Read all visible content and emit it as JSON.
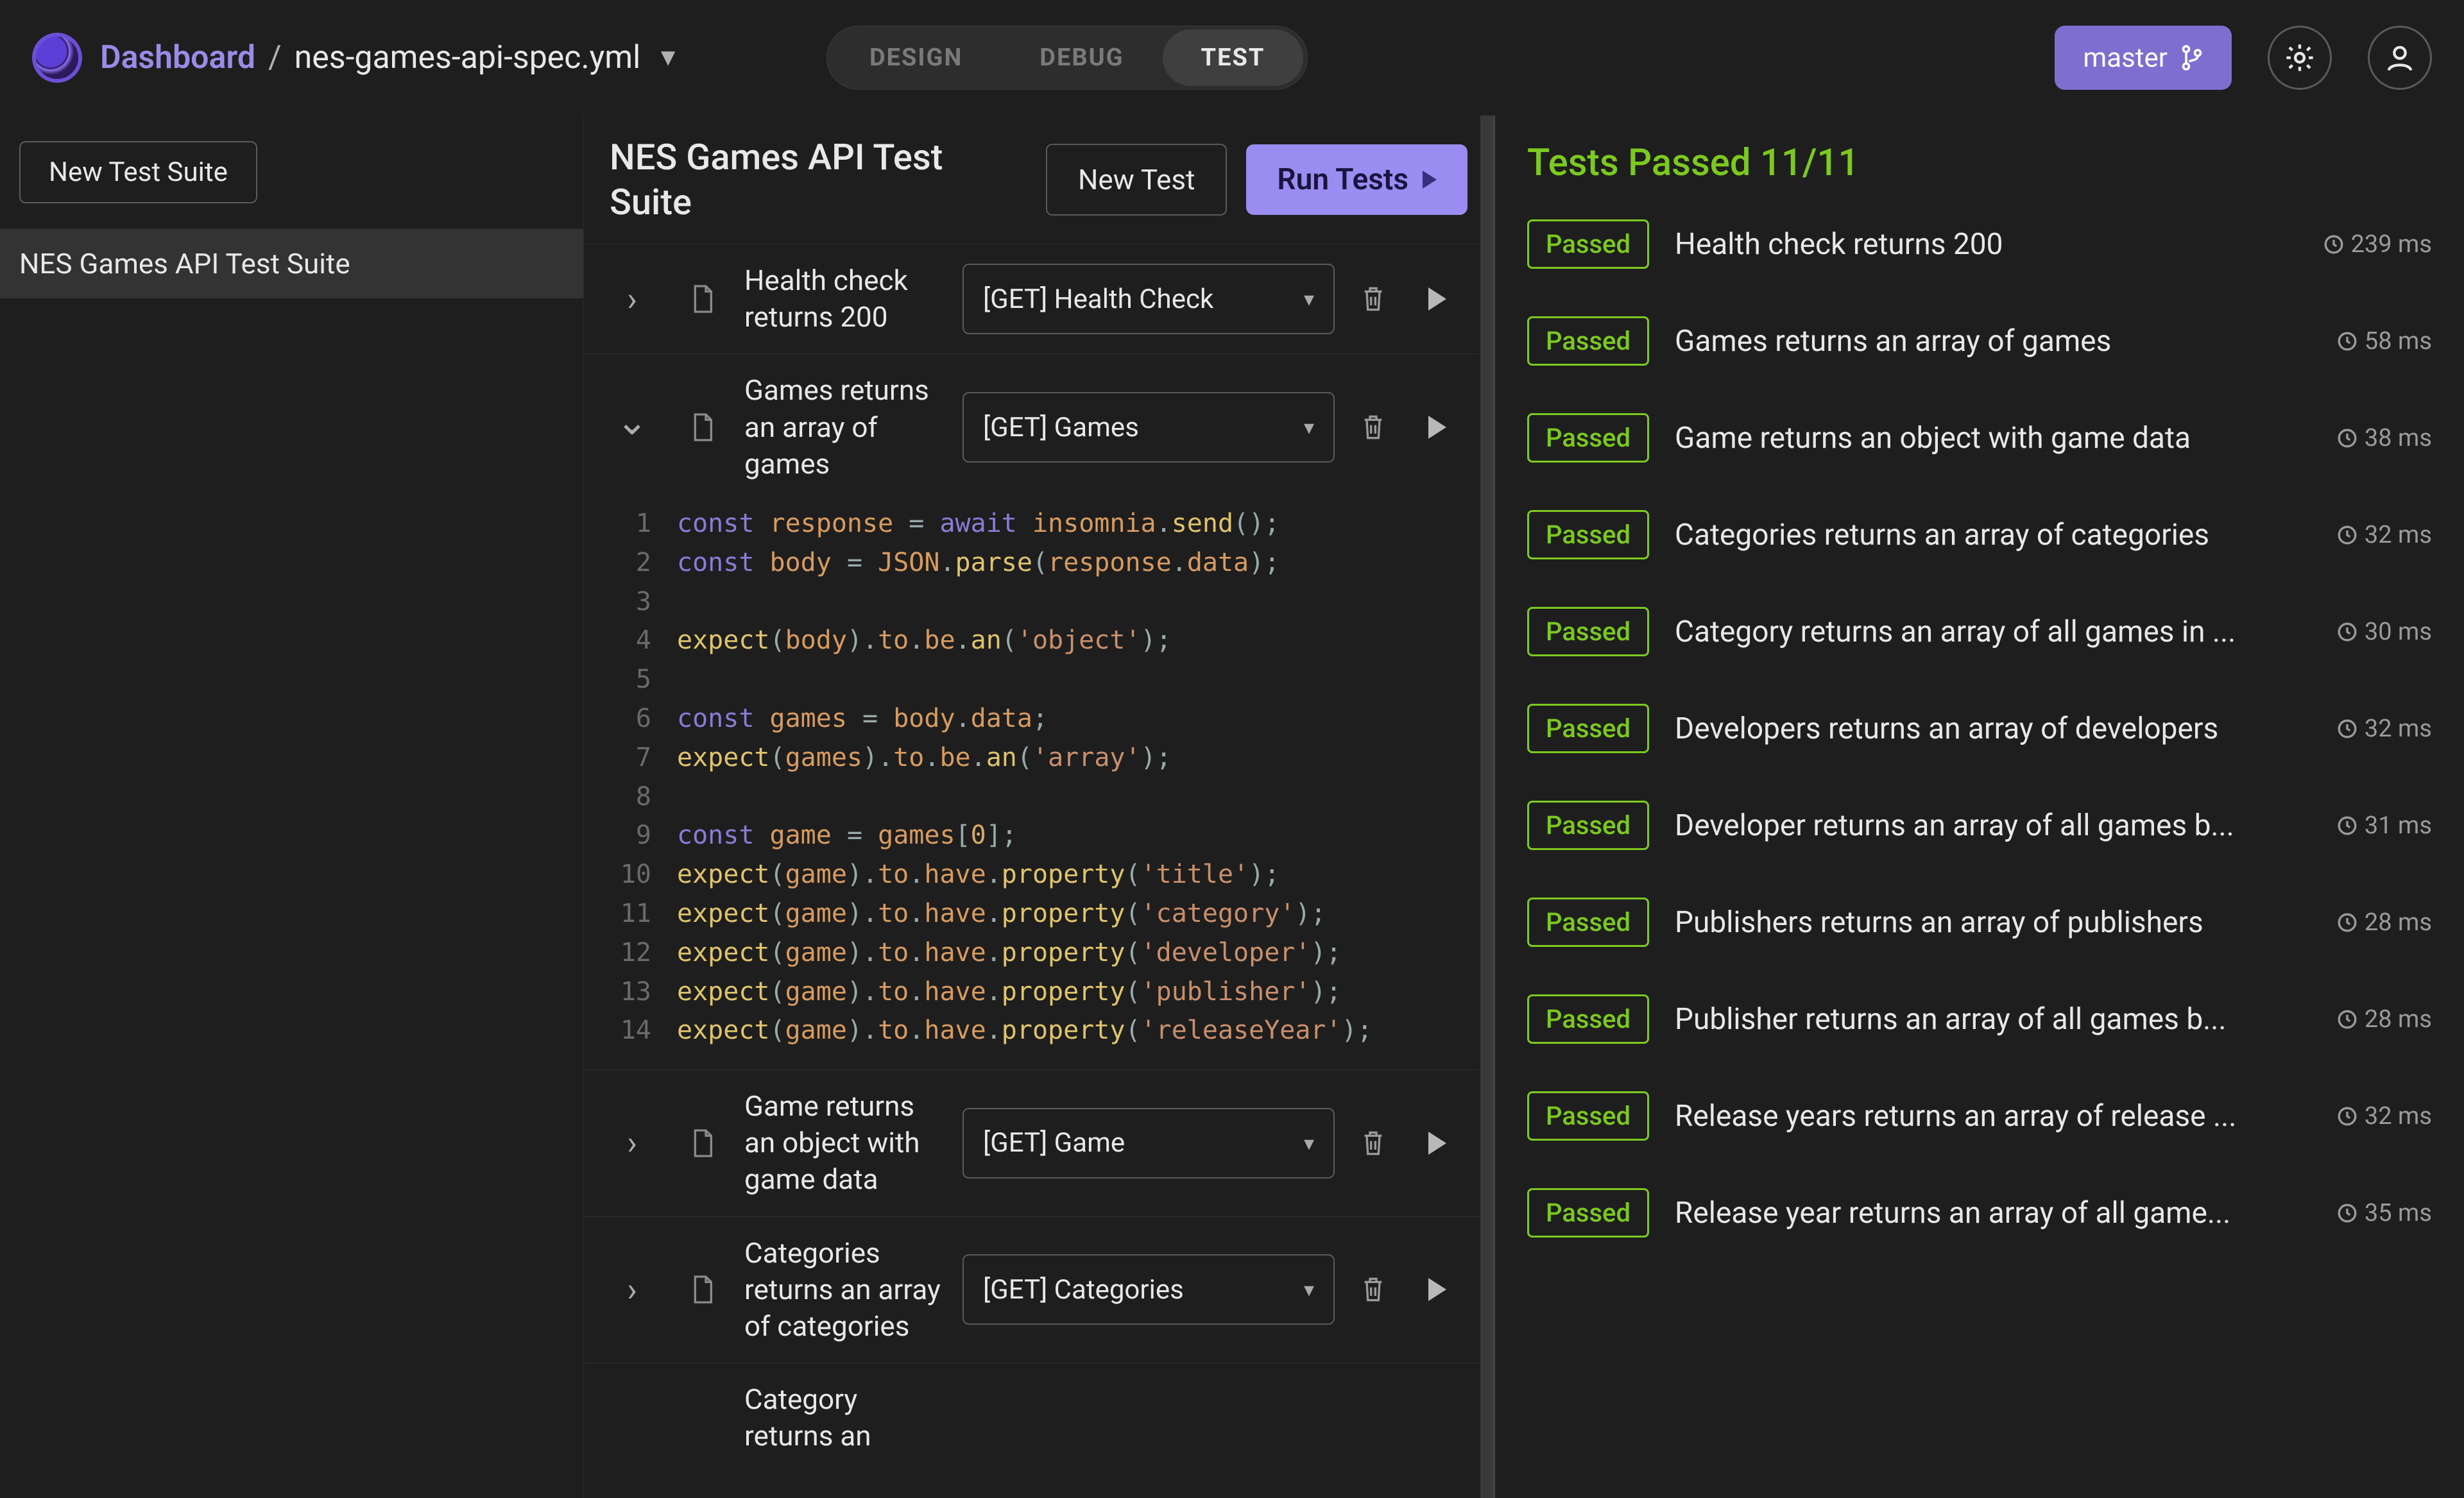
{
  "header": {
    "dashboard_label": "Dashboard",
    "file_name": "nes-games-api-spec.yml",
    "modes": {
      "design": "DESIGN",
      "debug": "DEBUG",
      "test": "TEST",
      "active": "test"
    },
    "branch": "master"
  },
  "sidebar": {
    "new_suite_label": "New Test Suite",
    "suites": [
      {
        "name": "NES Games API Test Suite"
      }
    ]
  },
  "mid": {
    "title": "NES Games API Test Suite",
    "new_test_label": "New Test",
    "run_tests_label": "Run Tests",
    "tests": [
      {
        "name": "Health check returns 200",
        "request": "[GET] Health Check",
        "expanded": false
      },
      {
        "name": "Games returns an array of games",
        "request": "[GET] Games",
        "expanded": true
      },
      {
        "name": "Game returns an object with game data",
        "request": "[GET] Game",
        "expanded": false
      },
      {
        "name": "Categories returns an array of categories",
        "request": "[GET] Categories",
        "expanded": false
      },
      {
        "name": "Category returns an",
        "request": "",
        "expanded": false
      }
    ],
    "code_lines": [
      [
        {
          "t": "kw",
          "v": "const"
        },
        {
          "t": "sp"
        },
        {
          "t": "vr",
          "v": "response"
        },
        {
          "t": "sp"
        },
        {
          "t": "dt",
          "v": "="
        },
        {
          "t": "sp"
        },
        {
          "t": "kw",
          "v": "await"
        },
        {
          "t": "sp"
        },
        {
          "t": "vr",
          "v": "insomnia"
        },
        {
          "t": "dt",
          "v": "."
        },
        {
          "t": "fn",
          "v": "send"
        },
        {
          "t": "dt",
          "v": "();"
        }
      ],
      [
        {
          "t": "kw",
          "v": "const"
        },
        {
          "t": "sp"
        },
        {
          "t": "vr",
          "v": "body"
        },
        {
          "t": "sp"
        },
        {
          "t": "dt",
          "v": "="
        },
        {
          "t": "sp"
        },
        {
          "t": "vr",
          "v": "JSON"
        },
        {
          "t": "dt",
          "v": "."
        },
        {
          "t": "fn",
          "v": "parse"
        },
        {
          "t": "dt",
          "v": "("
        },
        {
          "t": "vr",
          "v": "response"
        },
        {
          "t": "dt",
          "v": "."
        },
        {
          "t": "vr",
          "v": "data"
        },
        {
          "t": "dt",
          "v": ");"
        }
      ],
      [],
      [
        {
          "t": "fn",
          "v": "expect"
        },
        {
          "t": "dt",
          "v": "("
        },
        {
          "t": "vr",
          "v": "body"
        },
        {
          "t": "dt",
          "v": ")."
        },
        {
          "t": "vr",
          "v": "to"
        },
        {
          "t": "dt",
          "v": "."
        },
        {
          "t": "vr",
          "v": "be"
        },
        {
          "t": "dt",
          "v": "."
        },
        {
          "t": "fn",
          "v": "an"
        },
        {
          "t": "dt",
          "v": "("
        },
        {
          "t": "st",
          "v": "'object'"
        },
        {
          "t": "dt",
          "v": ");"
        }
      ],
      [],
      [
        {
          "t": "kw",
          "v": "const"
        },
        {
          "t": "sp"
        },
        {
          "t": "vr",
          "v": "games"
        },
        {
          "t": "sp"
        },
        {
          "t": "dt",
          "v": "="
        },
        {
          "t": "sp"
        },
        {
          "t": "vr",
          "v": "body"
        },
        {
          "t": "dt",
          "v": "."
        },
        {
          "t": "vr",
          "v": "data"
        },
        {
          "t": "dt",
          "v": ";"
        }
      ],
      [
        {
          "t": "fn",
          "v": "expect"
        },
        {
          "t": "dt",
          "v": "("
        },
        {
          "t": "vr",
          "v": "games"
        },
        {
          "t": "dt",
          "v": ")."
        },
        {
          "t": "vr",
          "v": "to"
        },
        {
          "t": "dt",
          "v": "."
        },
        {
          "t": "vr",
          "v": "be"
        },
        {
          "t": "dt",
          "v": "."
        },
        {
          "t": "fn",
          "v": "an"
        },
        {
          "t": "dt",
          "v": "("
        },
        {
          "t": "st",
          "v": "'array'"
        },
        {
          "t": "dt",
          "v": ");"
        }
      ],
      [],
      [
        {
          "t": "kw",
          "v": "const"
        },
        {
          "t": "sp"
        },
        {
          "t": "vr",
          "v": "game"
        },
        {
          "t": "sp"
        },
        {
          "t": "dt",
          "v": "="
        },
        {
          "t": "sp"
        },
        {
          "t": "vr",
          "v": "games"
        },
        {
          "t": "dt",
          "v": "["
        },
        {
          "t": "nm",
          "v": "0"
        },
        {
          "t": "dt",
          "v": "];"
        }
      ],
      [
        {
          "t": "fn",
          "v": "expect"
        },
        {
          "t": "dt",
          "v": "("
        },
        {
          "t": "vr",
          "v": "game"
        },
        {
          "t": "dt",
          "v": ")."
        },
        {
          "t": "vr",
          "v": "to"
        },
        {
          "t": "dt",
          "v": "."
        },
        {
          "t": "vr",
          "v": "have"
        },
        {
          "t": "dt",
          "v": "."
        },
        {
          "t": "fn",
          "v": "property"
        },
        {
          "t": "dt",
          "v": "("
        },
        {
          "t": "st",
          "v": "'title'"
        },
        {
          "t": "dt",
          "v": ");"
        }
      ],
      [
        {
          "t": "fn",
          "v": "expect"
        },
        {
          "t": "dt",
          "v": "("
        },
        {
          "t": "vr",
          "v": "game"
        },
        {
          "t": "dt",
          "v": ")."
        },
        {
          "t": "vr",
          "v": "to"
        },
        {
          "t": "dt",
          "v": "."
        },
        {
          "t": "vr",
          "v": "have"
        },
        {
          "t": "dt",
          "v": "."
        },
        {
          "t": "fn",
          "v": "property"
        },
        {
          "t": "dt",
          "v": "("
        },
        {
          "t": "st",
          "v": "'category'"
        },
        {
          "t": "dt",
          "v": ");"
        }
      ],
      [
        {
          "t": "fn",
          "v": "expect"
        },
        {
          "t": "dt",
          "v": "("
        },
        {
          "t": "vr",
          "v": "game"
        },
        {
          "t": "dt",
          "v": ")."
        },
        {
          "t": "vr",
          "v": "to"
        },
        {
          "t": "dt",
          "v": "."
        },
        {
          "t": "vr",
          "v": "have"
        },
        {
          "t": "dt",
          "v": "."
        },
        {
          "t": "fn",
          "v": "property"
        },
        {
          "t": "dt",
          "v": "("
        },
        {
          "t": "st",
          "v": "'developer'"
        },
        {
          "t": "dt",
          "v": ");"
        }
      ],
      [
        {
          "t": "fn",
          "v": "expect"
        },
        {
          "t": "dt",
          "v": "("
        },
        {
          "t": "vr",
          "v": "game"
        },
        {
          "t": "dt",
          "v": ")."
        },
        {
          "t": "vr",
          "v": "to"
        },
        {
          "t": "dt",
          "v": "."
        },
        {
          "t": "vr",
          "v": "have"
        },
        {
          "t": "dt",
          "v": "."
        },
        {
          "t": "fn",
          "v": "property"
        },
        {
          "t": "dt",
          "v": "("
        },
        {
          "t": "st",
          "v": "'publisher'"
        },
        {
          "t": "dt",
          "v": ");"
        }
      ],
      [
        {
          "t": "fn",
          "v": "expect"
        },
        {
          "t": "dt",
          "v": "("
        },
        {
          "t": "vr",
          "v": "game"
        },
        {
          "t": "dt",
          "v": ")."
        },
        {
          "t": "vr",
          "v": "to"
        },
        {
          "t": "dt",
          "v": "."
        },
        {
          "t": "vr",
          "v": "have"
        },
        {
          "t": "dt",
          "v": "."
        },
        {
          "t": "fn",
          "v": "property"
        },
        {
          "t": "dt",
          "v": "("
        },
        {
          "t": "st",
          "v": "'releaseYear'"
        },
        {
          "t": "dt",
          "v": ");"
        }
      ]
    ]
  },
  "results": {
    "title": "Tests Passed 11/11",
    "passed_label": "Passed",
    "items": [
      {
        "name": "Health check returns 200",
        "time": "239 ms"
      },
      {
        "name": "Games returns an array of games",
        "time": "58 ms"
      },
      {
        "name": "Game returns an object with game data",
        "time": "38 ms"
      },
      {
        "name": "Categories returns an array of categories",
        "time": "32 ms"
      },
      {
        "name": "Category returns an array of all games in ...",
        "time": "30 ms"
      },
      {
        "name": "Developers returns an array of developers",
        "time": "32 ms"
      },
      {
        "name": "Developer returns an array of all games b...",
        "time": "31 ms"
      },
      {
        "name": "Publishers returns an array of publishers",
        "time": "28 ms"
      },
      {
        "name": "Publisher returns an array of all games b...",
        "time": "28 ms"
      },
      {
        "name": "Release years returns an array of release ...",
        "time": "32 ms"
      },
      {
        "name": "Release year returns an array of all game...",
        "time": "35 ms"
      }
    ]
  }
}
